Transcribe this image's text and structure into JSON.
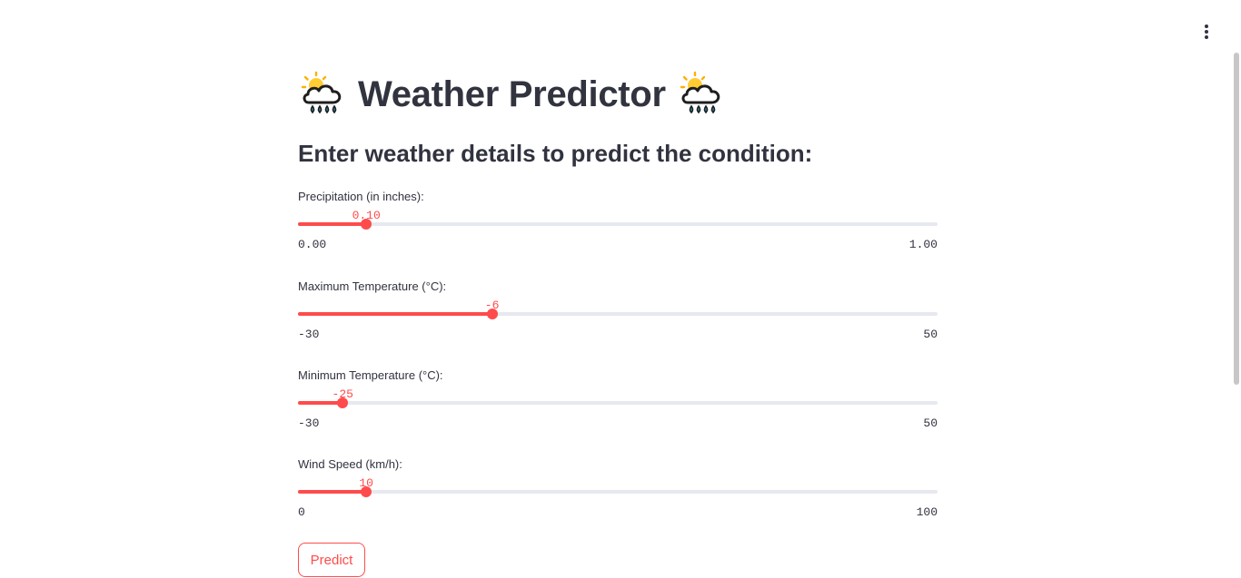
{
  "header": {
    "menu_icon": "vertical-ellipsis-icon"
  },
  "title": {
    "text": "Weather Predictor",
    "icon_left": "sun-behind-rain-cloud-icon",
    "icon_right": "sun-behind-rain-cloud-icon"
  },
  "subtitle": "Enter weather details to predict the condition:",
  "sliders": [
    {
      "label": "Precipitation (in inches):",
      "value": 0.1,
      "value_text": "0.10",
      "min": 0,
      "max": 1,
      "min_text": "0.00",
      "max_text": "1.00"
    },
    {
      "label": "Maximum Temperature (°C):",
      "value": -6,
      "value_text": "-6",
      "min": -30,
      "max": 50,
      "min_text": "-30",
      "max_text": "50"
    },
    {
      "label": "Minimum Temperature (°C):",
      "value": -25,
      "value_text": "-25",
      "min": -30,
      "max": 50,
      "min_text": "-30",
      "max_text": "50"
    },
    {
      "label": "Wind Speed (km/h):",
      "value": 10,
      "value_text": "10",
      "min": 0,
      "max": 100,
      "min_text": "0",
      "max_text": "100"
    }
  ],
  "predict_button": "Predict",
  "colors": {
    "accent": "#ff4b4b",
    "text": "#31333f",
    "track": "#e6e9ef"
  }
}
